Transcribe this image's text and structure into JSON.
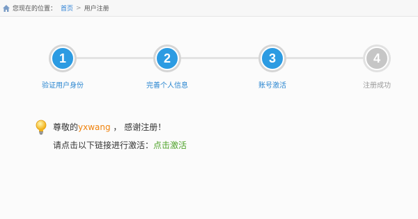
{
  "breadcrumb": {
    "prefix": "您现在的位置：",
    "home": "首页",
    "separator": ">",
    "current": "用户注册"
  },
  "steps": [
    {
      "number": "1",
      "label": "验证用户身份",
      "state": "completed"
    },
    {
      "number": "2",
      "label": "完善个人信息",
      "state": "completed"
    },
    {
      "number": "3",
      "label": "账号激活",
      "state": "current"
    },
    {
      "number": "4",
      "label": "注册成功",
      "state": "pending"
    }
  ],
  "message": {
    "greeting_prefix": "尊敬的",
    "username": "yxwang",
    "greeting_suffix": " ，  感谢注册！",
    "instruction": "请点击以下链接进行激活：",
    "activate_link": "点击激活"
  },
  "colors": {
    "step_active": "#2c9be2",
    "step_inactive": "#c6c6c6",
    "username": "#f0820c",
    "link": "#4fa32a"
  }
}
